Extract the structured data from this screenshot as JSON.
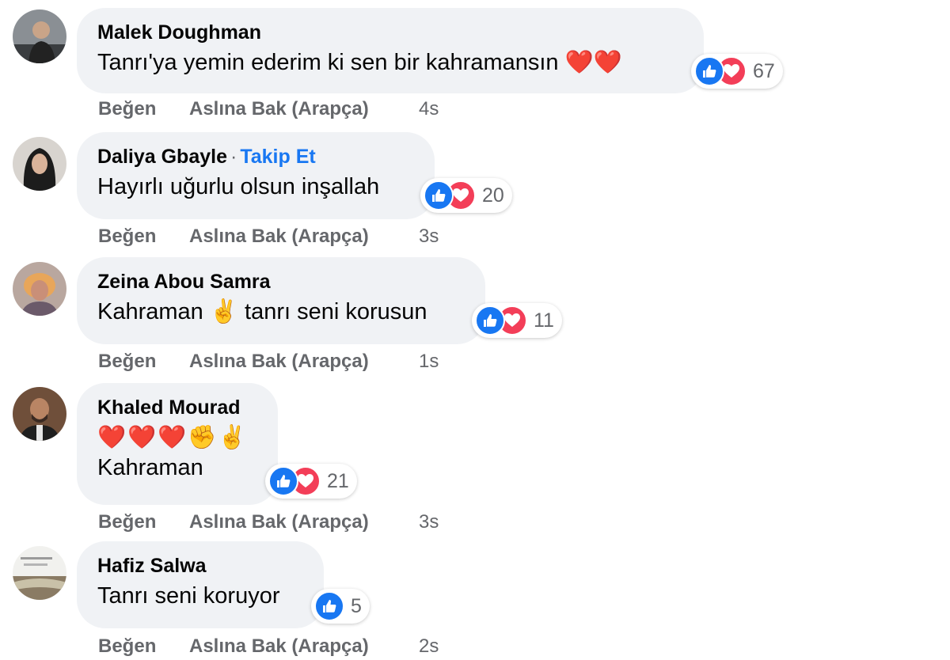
{
  "colors": {
    "like": "#1877f2",
    "love": "#f33e58",
    "link": "#1877f2",
    "bubble": "#f0f2f5",
    "meta": "#65676b"
  },
  "actions": {
    "like_label": "Beğen",
    "translate_label": "Aslına Bak (Arapça)"
  },
  "comments": [
    {
      "author": "Malek Doughman",
      "follow": "",
      "text": "Tanrı'ya yemin ederim ki sen bir kahramansın ❤️❤️",
      "emojis": "",
      "reactions": [
        "like",
        "love"
      ],
      "reaction_count": "67",
      "time": "4s"
    },
    {
      "author": "Daliya Gbayle",
      "follow": "Takip Et",
      "text": "Hayırlı uğurlu olsun inşallah",
      "emojis": "",
      "reactions": [
        "like",
        "love"
      ],
      "reaction_count": "20",
      "time": "3s"
    },
    {
      "author": "Zeina Abou Samra",
      "follow": "",
      "text": "Kahraman ✌️ tanrı seni korusun",
      "emojis": "",
      "reactions": [
        "like",
        "love"
      ],
      "reaction_count": "11",
      "time": "1s"
    },
    {
      "author": "Khaled Mourad",
      "follow": "",
      "text": "Kahraman",
      "emojis": "❤️❤️❤️✊✌️",
      "reactions": [
        "like",
        "love"
      ],
      "reaction_count": "21",
      "time": "3s"
    },
    {
      "author": "Hafiz Salwa",
      "follow": "",
      "text": "Tanrı seni koruyor",
      "emojis": "",
      "reactions": [
        "like"
      ],
      "reaction_count": "5",
      "time": "2s"
    }
  ]
}
